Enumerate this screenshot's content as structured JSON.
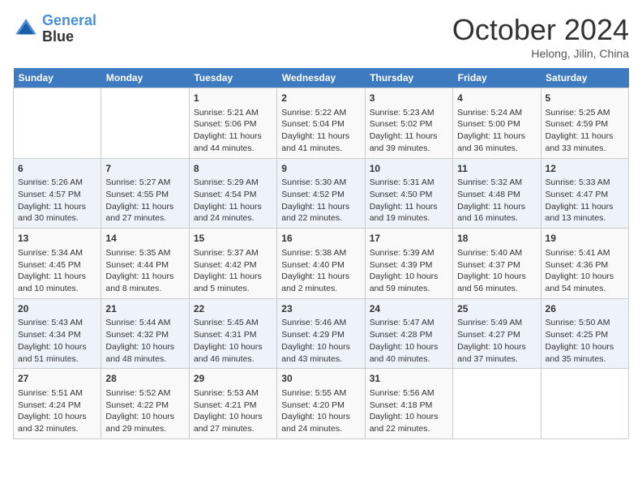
{
  "header": {
    "logo_line1": "General",
    "logo_line2": "Blue",
    "month": "October 2024",
    "location": "Helong, Jilin, China"
  },
  "weekdays": [
    "Sunday",
    "Monday",
    "Tuesday",
    "Wednesday",
    "Thursday",
    "Friday",
    "Saturday"
  ],
  "weeks": [
    [
      {
        "day": "",
        "info": ""
      },
      {
        "day": "",
        "info": ""
      },
      {
        "day": "1",
        "info": "Sunrise: 5:21 AM\nSunset: 5:06 PM\nDaylight: 11 hours and 44 minutes."
      },
      {
        "day": "2",
        "info": "Sunrise: 5:22 AM\nSunset: 5:04 PM\nDaylight: 11 hours and 41 minutes."
      },
      {
        "day": "3",
        "info": "Sunrise: 5:23 AM\nSunset: 5:02 PM\nDaylight: 11 hours and 39 minutes."
      },
      {
        "day": "4",
        "info": "Sunrise: 5:24 AM\nSunset: 5:00 PM\nDaylight: 11 hours and 36 minutes."
      },
      {
        "day": "5",
        "info": "Sunrise: 5:25 AM\nSunset: 4:59 PM\nDaylight: 11 hours and 33 minutes."
      }
    ],
    [
      {
        "day": "6",
        "info": "Sunrise: 5:26 AM\nSunset: 4:57 PM\nDaylight: 11 hours and 30 minutes."
      },
      {
        "day": "7",
        "info": "Sunrise: 5:27 AM\nSunset: 4:55 PM\nDaylight: 11 hours and 27 minutes."
      },
      {
        "day": "8",
        "info": "Sunrise: 5:29 AM\nSunset: 4:54 PM\nDaylight: 11 hours and 24 minutes."
      },
      {
        "day": "9",
        "info": "Sunrise: 5:30 AM\nSunset: 4:52 PM\nDaylight: 11 hours and 22 minutes."
      },
      {
        "day": "10",
        "info": "Sunrise: 5:31 AM\nSunset: 4:50 PM\nDaylight: 11 hours and 19 minutes."
      },
      {
        "day": "11",
        "info": "Sunrise: 5:32 AM\nSunset: 4:48 PM\nDaylight: 11 hours and 16 minutes."
      },
      {
        "day": "12",
        "info": "Sunrise: 5:33 AM\nSunset: 4:47 PM\nDaylight: 11 hours and 13 minutes."
      }
    ],
    [
      {
        "day": "13",
        "info": "Sunrise: 5:34 AM\nSunset: 4:45 PM\nDaylight: 11 hours and 10 minutes."
      },
      {
        "day": "14",
        "info": "Sunrise: 5:35 AM\nSunset: 4:44 PM\nDaylight: 11 hours and 8 minutes."
      },
      {
        "day": "15",
        "info": "Sunrise: 5:37 AM\nSunset: 4:42 PM\nDaylight: 11 hours and 5 minutes."
      },
      {
        "day": "16",
        "info": "Sunrise: 5:38 AM\nSunset: 4:40 PM\nDaylight: 11 hours and 2 minutes."
      },
      {
        "day": "17",
        "info": "Sunrise: 5:39 AM\nSunset: 4:39 PM\nDaylight: 10 hours and 59 minutes."
      },
      {
        "day": "18",
        "info": "Sunrise: 5:40 AM\nSunset: 4:37 PM\nDaylight: 10 hours and 56 minutes."
      },
      {
        "day": "19",
        "info": "Sunrise: 5:41 AM\nSunset: 4:36 PM\nDaylight: 10 hours and 54 minutes."
      }
    ],
    [
      {
        "day": "20",
        "info": "Sunrise: 5:43 AM\nSunset: 4:34 PM\nDaylight: 10 hours and 51 minutes."
      },
      {
        "day": "21",
        "info": "Sunrise: 5:44 AM\nSunset: 4:32 PM\nDaylight: 10 hours and 48 minutes."
      },
      {
        "day": "22",
        "info": "Sunrise: 5:45 AM\nSunset: 4:31 PM\nDaylight: 10 hours and 46 minutes."
      },
      {
        "day": "23",
        "info": "Sunrise: 5:46 AM\nSunset: 4:29 PM\nDaylight: 10 hours and 43 minutes."
      },
      {
        "day": "24",
        "info": "Sunrise: 5:47 AM\nSunset: 4:28 PM\nDaylight: 10 hours and 40 minutes."
      },
      {
        "day": "25",
        "info": "Sunrise: 5:49 AM\nSunset: 4:27 PM\nDaylight: 10 hours and 37 minutes."
      },
      {
        "day": "26",
        "info": "Sunrise: 5:50 AM\nSunset: 4:25 PM\nDaylight: 10 hours and 35 minutes."
      }
    ],
    [
      {
        "day": "27",
        "info": "Sunrise: 5:51 AM\nSunset: 4:24 PM\nDaylight: 10 hours and 32 minutes."
      },
      {
        "day": "28",
        "info": "Sunrise: 5:52 AM\nSunset: 4:22 PM\nDaylight: 10 hours and 29 minutes."
      },
      {
        "day": "29",
        "info": "Sunrise: 5:53 AM\nSunset: 4:21 PM\nDaylight: 10 hours and 27 minutes."
      },
      {
        "day": "30",
        "info": "Sunrise: 5:55 AM\nSunset: 4:20 PM\nDaylight: 10 hours and 24 minutes."
      },
      {
        "day": "31",
        "info": "Sunrise: 5:56 AM\nSunset: 4:18 PM\nDaylight: 10 hours and 22 minutes."
      },
      {
        "day": "",
        "info": ""
      },
      {
        "day": "",
        "info": ""
      }
    ]
  ]
}
